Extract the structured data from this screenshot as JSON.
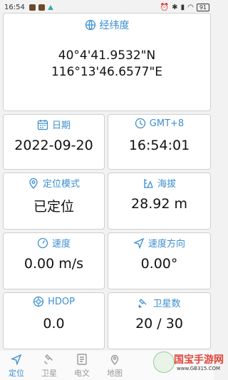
{
  "status": {
    "time": "16:54",
    "battery": "91"
  },
  "latlon": {
    "title": "经纬度",
    "lat": "40°4'41.9532\"N",
    "lon": "116°13'46.6577\"E"
  },
  "cards": {
    "date": {
      "label": "日期",
      "value": "2022-09-20"
    },
    "tz": {
      "label": "GMT+8",
      "value": "16:54:01"
    },
    "mode": {
      "label": "定位模式",
      "value": "已定位"
    },
    "altitude": {
      "label": "海拔",
      "value": "28.92 m"
    },
    "speed": {
      "label": "速度",
      "value": "0.00 m/s"
    },
    "heading": {
      "label": "速度方向",
      "value": "0.00°"
    },
    "hdop": {
      "label": "HDOP",
      "value": "0.0"
    },
    "satellites": {
      "label": "卫星数",
      "value": "20 / 30"
    }
  },
  "tabs": [
    {
      "label": "定位",
      "icon": "navigation-arrow-icon",
      "active": true
    },
    {
      "label": "卫星",
      "icon": "satellite-icon",
      "active": false
    },
    {
      "label": "电文",
      "icon": "document-icon",
      "active": false
    },
    {
      "label": "地图",
      "icon": "map-icon",
      "active": false
    }
  ],
  "watermark": {
    "text": "国宝手游网",
    "url": "www.GB315.COM"
  },
  "colors": {
    "accent": "#3d8fcf",
    "card_bg": "#ffffff",
    "page_bg": "#f2f2f2"
  }
}
